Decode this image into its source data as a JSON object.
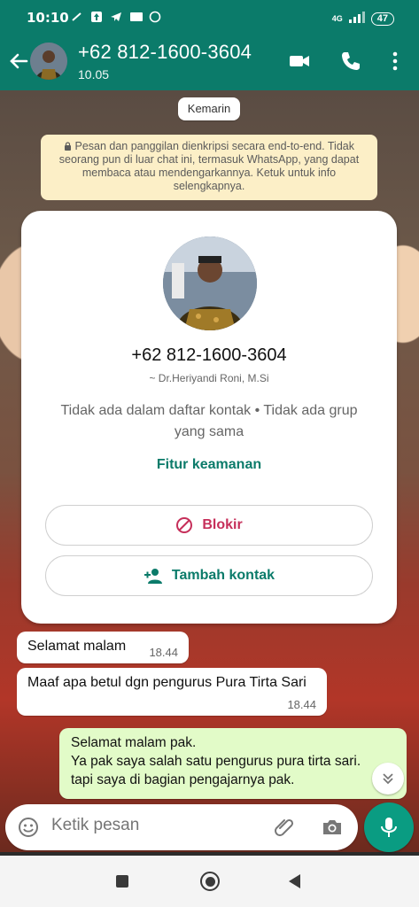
{
  "status": {
    "time": "10:10",
    "battery": "47",
    "network": "4G"
  },
  "header": {
    "title": "+62 812-1600-3604",
    "subtitle": "10.05"
  },
  "chat": {
    "date_chip": "Kemarin",
    "encryption_notice": "Pesan dan panggilan dienkripsi secara end-to-end. Tidak seorang pun di luar chat ini, termasuk WhatsApp, yang dapat membaca atau mendengarkannya. Ketuk untuk info selengkapnya.",
    "contact_card": {
      "phone": "+62 812-1600-3604",
      "name": "~ Dr.Heriyandi Roni, M.Si",
      "info": "Tidak ada dalam daftar kontak • Tidak ada grup yang sama",
      "security": "Fitur keamanan",
      "block_label": "Blokir",
      "add_label": "Tambah kontak"
    },
    "messages": [
      {
        "text": "Selamat malam",
        "time": "18.44"
      },
      {
        "text": "Maaf apa betul dgn pengurus Pura Tirta Sari",
        "time": "18.44"
      }
    ],
    "outgoing": {
      "line1": "Selamat malam pak.",
      "line2": "Ya pak saya salah satu pengurus pura tirta sari.",
      "line3": "tapi saya di bagian pengajarnya pak."
    }
  },
  "composer": {
    "placeholder": "Ketik pesan"
  },
  "colors": {
    "primary": "#0b7b6a",
    "block": "#c62f5a",
    "outgoing_bubble": "#e2fbc8",
    "notice_bg": "#fcefc7"
  }
}
